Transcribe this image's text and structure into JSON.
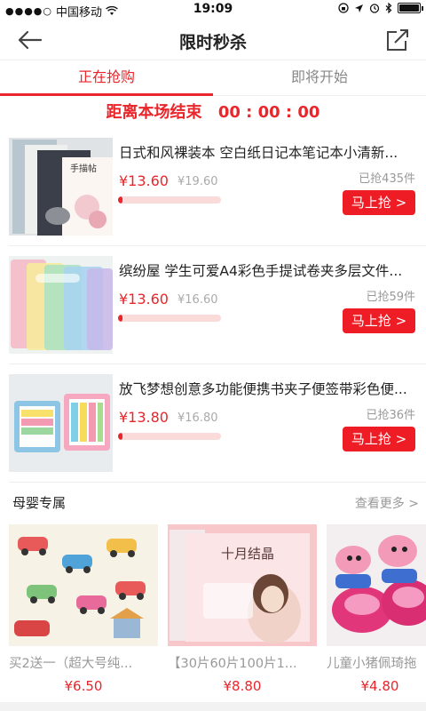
{
  "status_bar": {
    "carrier": "中国移动",
    "time": "19:09"
  },
  "header": {
    "title": "限时秒杀"
  },
  "tabs": [
    {
      "label": "正在抢购",
      "active": true
    },
    {
      "label": "即将开始",
      "active": false
    }
  ],
  "countdown": {
    "label": "距离本场结束",
    "time": "00 : 00 : 00"
  },
  "products": [
    {
      "title": "日式和风裸装本 空白纸日记本笔记本小清新...",
      "price": "¥13.60",
      "original_price": "¥19.60",
      "sold": "已抢435件",
      "progress": 0.04,
      "button": "马上抢 >",
      "image_text": "手描帖"
    },
    {
      "title": "缤纷屋 学生可爱A4彩色手提试卷夹多层文件...",
      "price": "¥13.60",
      "original_price": "¥16.60",
      "sold": "已抢59件",
      "progress": 0.04,
      "button": "马上抢 >"
    },
    {
      "title": "放飞梦想创意多功能便携书夹子便签带彩色便...",
      "price": "¥13.80",
      "original_price": "¥16.80",
      "sold": "已抢36件",
      "progress": 0.04,
      "button": "马上抢 >"
    }
  ],
  "section": {
    "title": "母婴专属",
    "more": "查看更多 >"
  },
  "cards": [
    {
      "title": "买2送一（超大号纯...",
      "price": "¥6.50"
    },
    {
      "title": "【30片60片100片1...",
      "price": "¥8.80",
      "image_text": "十月结晶"
    },
    {
      "title": "儿童小猪佩琦拖",
      "price": "¥4.80"
    }
  ],
  "colors": {
    "accent": "#e8262b",
    "button": "#ee1c25"
  }
}
